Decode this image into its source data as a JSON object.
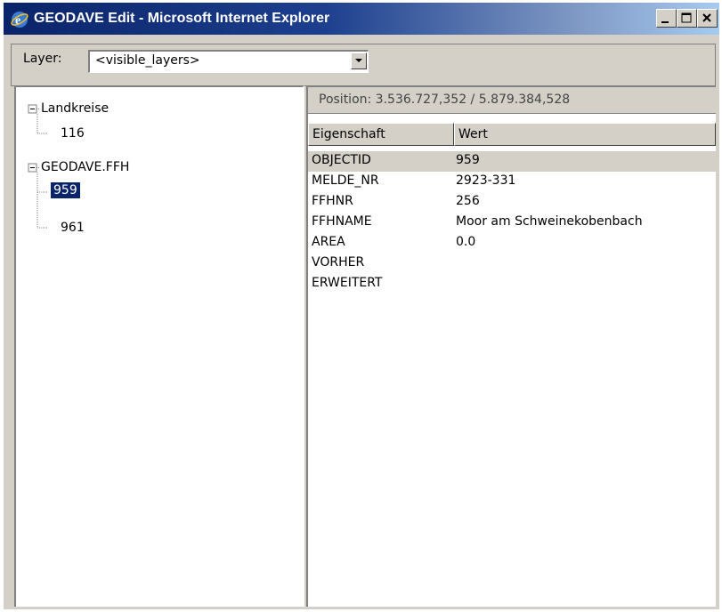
{
  "window": {
    "title": "GEODAVE Edit - Microsoft Internet Explorer",
    "buttons": [
      "minimize-icon",
      "maximize-icon",
      "close-icon"
    ]
  },
  "toolbar": {
    "layer_label": "Layer:",
    "layer_value": "<visible_layers>"
  },
  "tree": {
    "groups": [
      {
        "label": "Landkreise",
        "children": [
          "116"
        ]
      },
      {
        "label": "GEODAVE.FFH",
        "children": [
          "959",
          "961"
        ],
        "selected": "959"
      }
    ]
  },
  "details": {
    "position_text": "Position: 3.536.727,352 / 5.879.384,528",
    "columns": [
      "Eigenschaft",
      "Wert"
    ],
    "rows": [
      {
        "key": "OBJECTID",
        "value": "959"
      },
      {
        "key": "MELDE_NR",
        "value": "2923-331"
      },
      {
        "key": "FFHNR",
        "value": "256"
      },
      {
        "key": "FFHNAME",
        "value": "Moor am Schweinekobenbach"
      },
      {
        "key": "AREA",
        "value": "0.0"
      },
      {
        "key": "VORHER",
        "value": ""
      },
      {
        "key": "ERWEITERT",
        "value": ""
      }
    ],
    "selected_row": 0
  },
  "colors": {
    "titlebar_start": "#0a246a",
    "titlebar_end": "#a6caf0",
    "chrome": "#d4d0c8",
    "selection": "#0a246a"
  }
}
